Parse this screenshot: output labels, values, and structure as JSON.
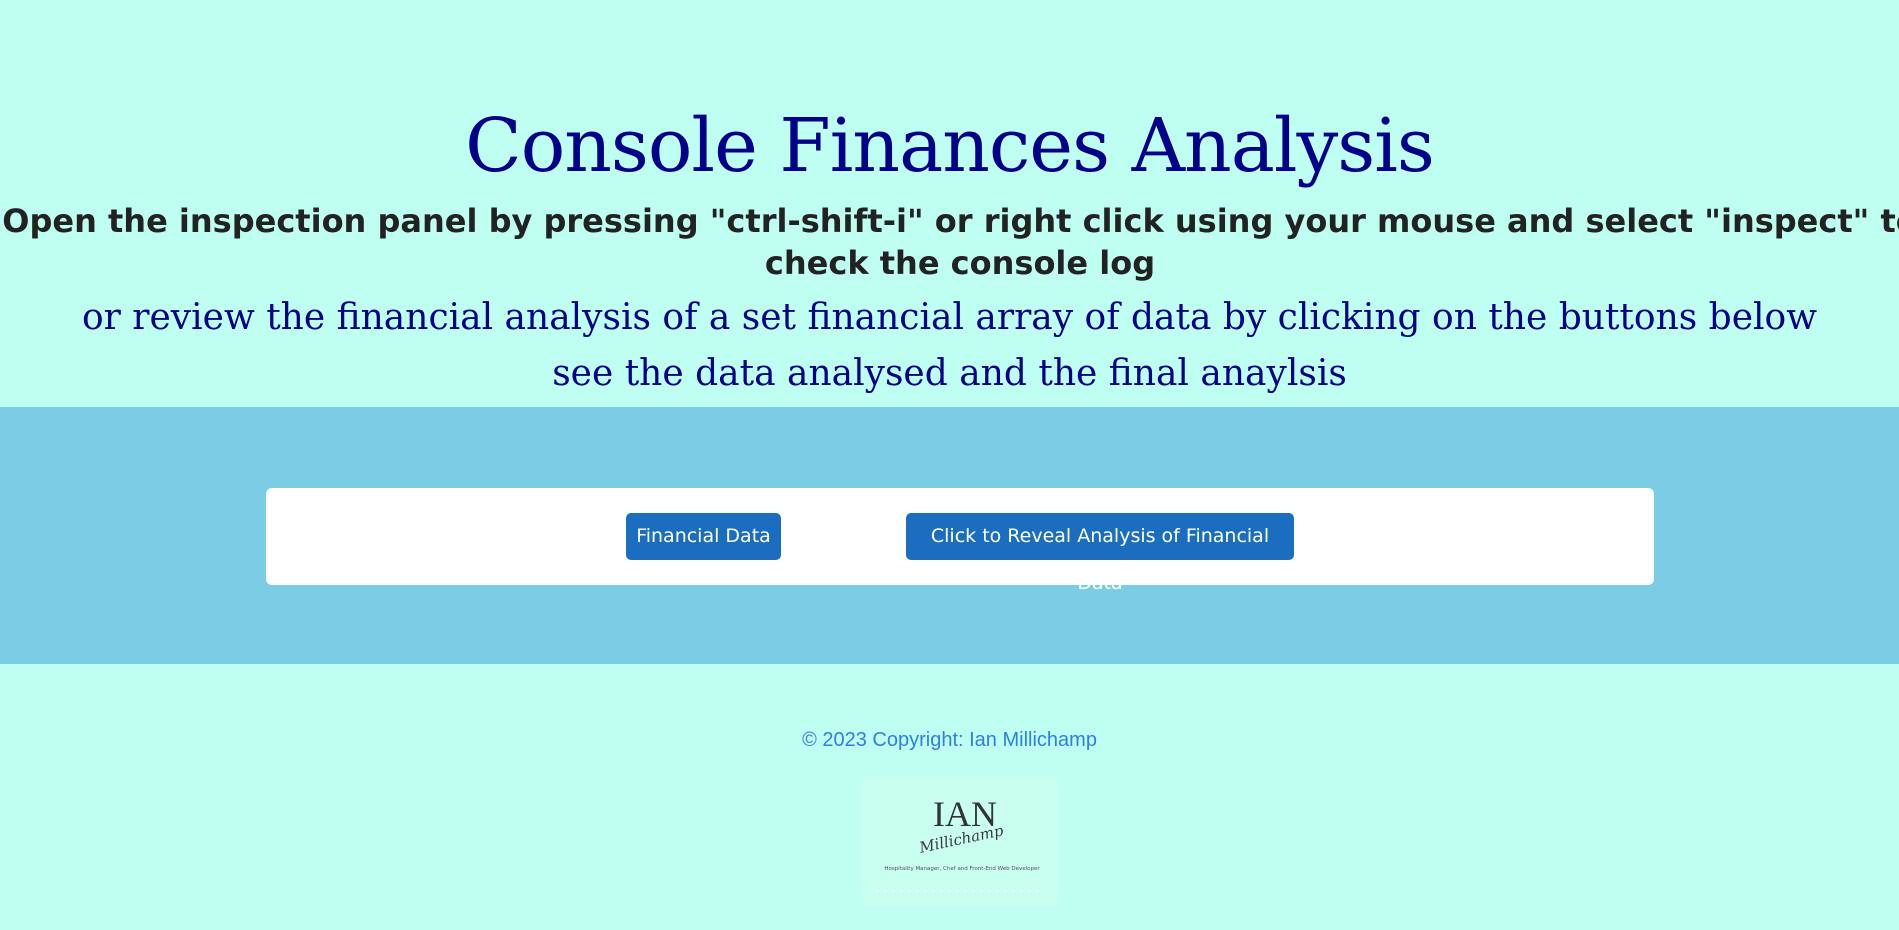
{
  "header": {
    "title": "Console Finances Analysis",
    "instruction": "Open the inspection panel by pressing \"ctrl-shift-i\" or right click using your mouse and select \"inspect\" to check the console log",
    "subtitle_line1": "or review the financial analysis of a set financial array of data by clicking on the buttons below",
    "subtitle_line2": "see the data analysed and the final anaylsis"
  },
  "buttons": {
    "financial_data": "Financial Data",
    "reveal_analysis": "Click to Reveal Analysis of Financial Data"
  },
  "footer": {
    "copyright": "© 2023 Copyright: Ian Millichamp",
    "logo": {
      "name": "IAN",
      "script": "Millichamp",
      "tagline": "Hospitality Manager, Chef and Front-End Web Developer"
    }
  },
  "colors": {
    "page_background": "#befff1",
    "band_background": "#7acde5",
    "title_color": "#00008b",
    "button_color": "#1b6ebf",
    "link_color": "#2f7fe0"
  }
}
